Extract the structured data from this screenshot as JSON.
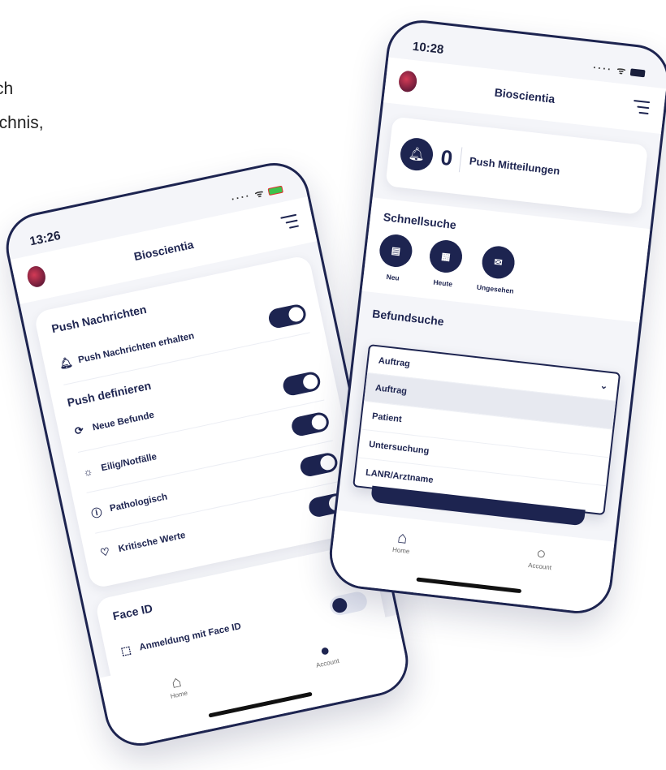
{
  "background_text": {
    "line1": "ch",
    "line2": "ichnis,"
  },
  "left_phone": {
    "time": "13:26",
    "app_title": "Bioscientia",
    "sections": {
      "push": {
        "title": "Push Nachrichten",
        "receive_label": "Push Nachrichten erhalten",
        "receive_enabled": true
      },
      "define": {
        "title": "Push definieren",
        "items": [
          {
            "label": "Neue Befunde",
            "icon": "refresh-icon",
            "enabled": true
          },
          {
            "label": "Eilig/Notfälle",
            "icon": "alarm-icon",
            "enabled": true
          },
          {
            "label": "Pathologisch",
            "icon": "info-icon",
            "enabled": true
          },
          {
            "label": "Kritische Werte",
            "icon": "heart-icon",
            "enabled": true
          }
        ]
      },
      "face_id": {
        "title": "Face ID",
        "label": "Anmeldung mit Face ID",
        "enabled": false
      }
    },
    "tabs": [
      {
        "label": "Home",
        "icon": "home-icon"
      },
      {
        "label": "Account",
        "icon": "user-icon"
      }
    ]
  },
  "right_phone": {
    "time": "10:28",
    "app_title": "Bioscientia",
    "push": {
      "count": "0",
      "label": "Push Mitteilungen"
    },
    "quick_search": {
      "title": "Schnellsuche",
      "items": [
        {
          "label": "Neu",
          "icon": "inbox-icon"
        },
        {
          "label": "Heute",
          "icon": "calendar-icon"
        },
        {
          "label": "Ungesehen",
          "icon": "mail-icon"
        }
      ]
    },
    "search": {
      "title": "Befundsuche",
      "dropdown": {
        "selected": "Auftrag",
        "options": [
          "Auftrag",
          "Patient",
          "Untersuchung",
          "LANR/Arztname"
        ]
      }
    },
    "tabs": [
      {
        "label": "Home",
        "icon": "home-icon"
      },
      {
        "label": "Account",
        "icon": "user-icon"
      }
    ]
  },
  "colors": {
    "primary": "#1d2450",
    "background": "#f4f5f9",
    "card": "#ffffff"
  }
}
